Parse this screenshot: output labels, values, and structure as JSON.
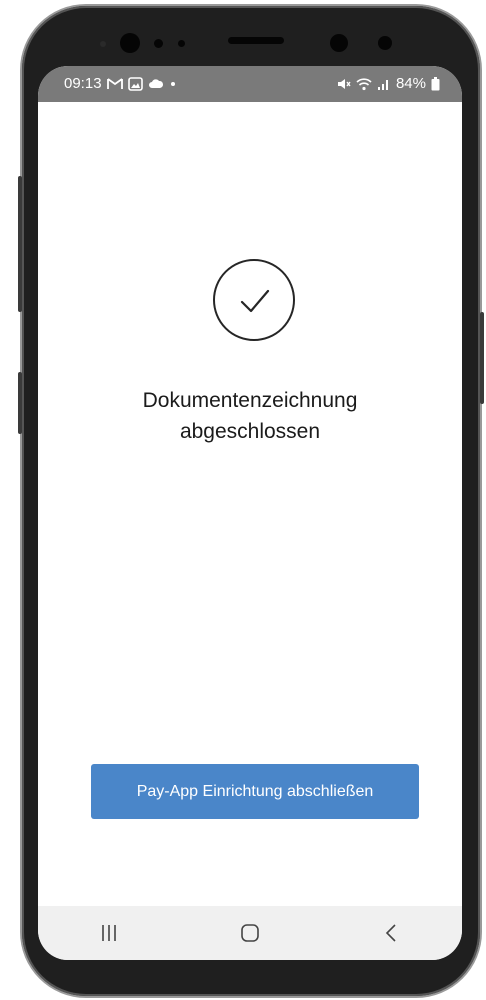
{
  "status_bar": {
    "time": "09:13",
    "battery": "84%",
    "icons": [
      "gmail-icon",
      "gallery-icon",
      "cloud-icon",
      "dot-icon",
      "mute-icon",
      "wifi-icon",
      "signal-icon",
      "battery-icon"
    ]
  },
  "main": {
    "success_icon": "checkmark-circle-icon",
    "title_line1": "Dokumentenzeichnung",
    "title_line2": "abgeschlossen",
    "primary_button_label": "Pay-App Einrichtung abschließen"
  },
  "navigation": {
    "items": [
      "recent-apps-icon",
      "home-icon",
      "back-icon"
    ]
  },
  "colors": {
    "button": "#4a86c9",
    "status_bar": "#7a7a7a",
    "nav_bar": "#f0f0f0",
    "phone_frame": "#1f1f1f"
  }
}
